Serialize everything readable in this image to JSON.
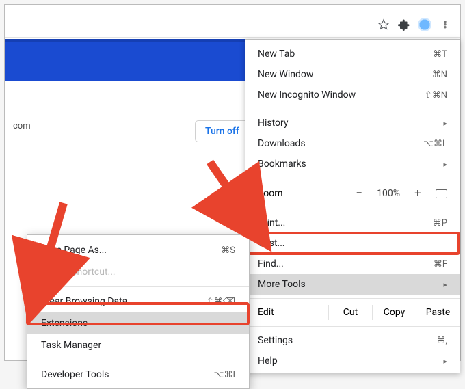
{
  "toolbar": {
    "star_icon": "bookmark-star-icon",
    "ext_icon": "extensions-icon",
    "profile_icon": "profile-avatar",
    "more_icon": "more-vert-icon"
  },
  "page": {
    "domain_fragment": "com",
    "turn_off_label": "Turn off"
  },
  "menu": {
    "new_tab": {
      "label": "New Tab",
      "kbd": "⌘T"
    },
    "new_window": {
      "label": "New Window",
      "kbd": "⌘N"
    },
    "incognito": {
      "label": "New Incognito Window",
      "kbd": "⇧⌘N"
    },
    "history": {
      "label": "History",
      "caret": "▸"
    },
    "downloads": {
      "label": "Downloads",
      "kbd": "⌥⌘L"
    },
    "bookmarks": {
      "label": "Bookmarks",
      "caret": "▸"
    },
    "zoom_label": "Zoom",
    "zoom_minus": "−",
    "zoom_value": "100%",
    "zoom_plus": "+",
    "print": {
      "label": "Print...",
      "kbd": "⌘P"
    },
    "cast": {
      "label": "Cast..."
    },
    "find": {
      "label": "Find...",
      "kbd": "⌘F"
    },
    "more_tools": {
      "label": "More Tools",
      "caret": "▸"
    },
    "edit_label": "Edit",
    "cut": "Cut",
    "copy": "Copy",
    "paste": "Paste",
    "settings": {
      "label": "Settings",
      "kbd": "⌘,"
    },
    "help": {
      "label": "Help",
      "caret": "▸"
    }
  },
  "submenu": {
    "save_page": {
      "label": "Save Page As...",
      "kbd": "⌘S"
    },
    "create_shortcut": {
      "label": "Create Shortcut..."
    },
    "clear_browsing": {
      "label": "Clear Browsing Data...",
      "kbd": "⇧⌘⌫"
    },
    "extensions": {
      "label": "Extensions"
    },
    "task_manager": {
      "label": "Task Manager"
    },
    "dev_tools": {
      "label": "Developer Tools",
      "kbd": "⌥⌘I"
    }
  }
}
